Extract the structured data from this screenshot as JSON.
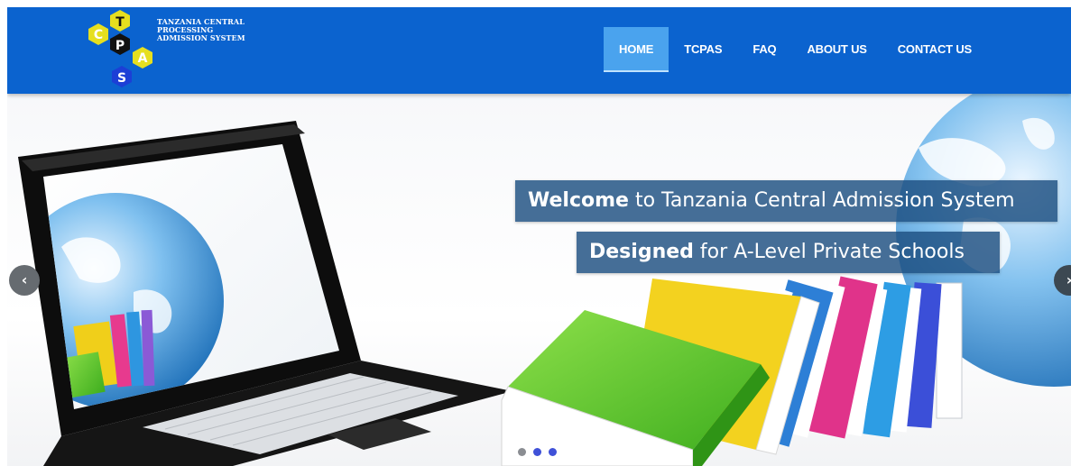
{
  "logo": {
    "letters": [
      "C",
      "T",
      "P",
      "A",
      "S"
    ],
    "text_lines": [
      "TANZANIA CENTRAL",
      "PROCESSING",
      "ADMISSION SYSTEM"
    ]
  },
  "nav": {
    "items": [
      {
        "label": "HOME",
        "active": true
      },
      {
        "label": "TCPAS",
        "active": false
      },
      {
        "label": "FAQ",
        "active": false
      },
      {
        "label": "ABOUT US",
        "active": false
      },
      {
        "label": "CONTACT US",
        "active": false
      }
    ]
  },
  "slider": {
    "caption_1": {
      "bold": "Welcome",
      "rest": " to Tanzania Central Admission System"
    },
    "caption_2": {
      "bold": "Designed",
      "rest": " for A-Level Private Schools"
    },
    "prev_icon": "chevron-left-icon",
    "next_icon": "chevron-right-icon",
    "prev_glyph": "‹",
    "next_glyph": "›",
    "dots": 3,
    "active_dot": 0
  },
  "colors": {
    "header": "#0b63cf",
    "nav_active": "#4aa3ee",
    "caption_bg": "#1c4e80",
    "logo_yellow": "#e6df1f",
    "logo_black": "#111111",
    "logo_blue": "#1c3fd6"
  }
}
